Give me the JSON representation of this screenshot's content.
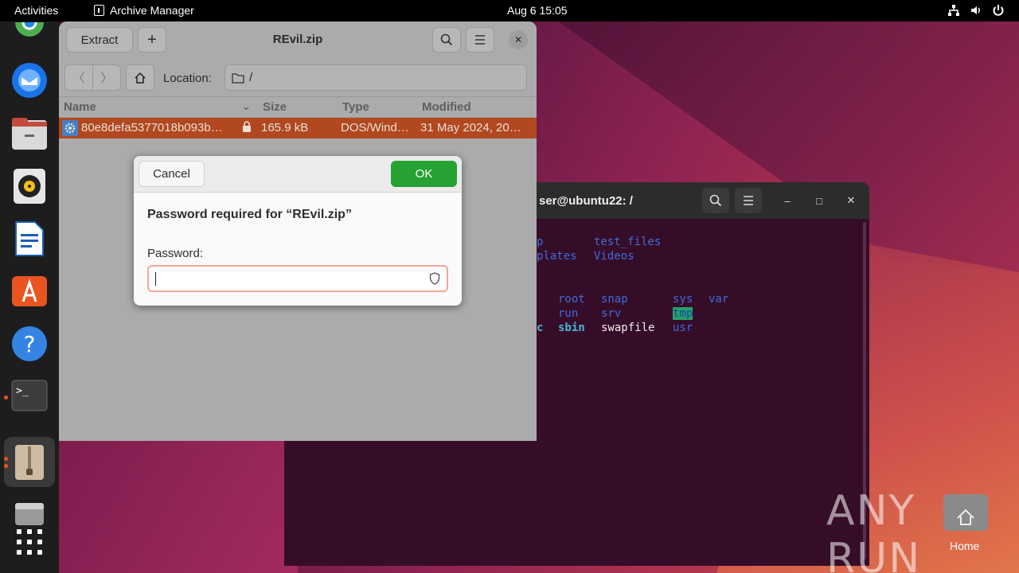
{
  "topbar": {
    "activities": "Activities",
    "app_name": "Archive Manager",
    "clock": "Aug 6  15:05"
  },
  "dock": {
    "items": [
      "chrome",
      "thunderbird",
      "files",
      "rhythmbox",
      "libreoffice-writer",
      "app-center",
      "help",
      "terminal",
      "archive-manager",
      "disk",
      "show-apps"
    ]
  },
  "archive": {
    "extract_label": "Extract",
    "title": "REvil.zip",
    "location_label": "Location:",
    "location_value": "/",
    "columns": {
      "name": "Name",
      "size": "Size",
      "type": "Type",
      "modified": "Modified"
    },
    "rows": [
      {
        "name": "80e8defa5377018b093b…",
        "size": "165.9 kB",
        "type": "DOS/Wind…",
        "modified": "31 May 2024, 20…"
      }
    ]
  },
  "dialog": {
    "cancel_label": "Cancel",
    "ok_label": "OK",
    "title": "Password required for “REvil.zip”",
    "password_label": "Password:",
    "password_value": ""
  },
  "terminal": {
    "title": "ser@ubuntu22: /",
    "lines": [
      {
        "a": "p",
        "b": "test_files"
      },
      {
        "a": "plates",
        "b": "Videos"
      }
    ],
    "dirs": {
      "r1": [
        "root",
        "snap",
        "sys",
        "var"
      ],
      "r2": [
        "run",
        "srv",
        "tmp"
      ],
      "r3": [
        "c",
        "sbin",
        "swapfile",
        "usr"
      ]
    }
  },
  "desktop": {
    "home_label": "Home",
    "watermark": "ANY RUN"
  },
  "colors": {
    "accent": "#e95420",
    "selected_row": "#b1481f",
    "ok_button": "#26a235",
    "terminal_bg": "#300a24"
  }
}
